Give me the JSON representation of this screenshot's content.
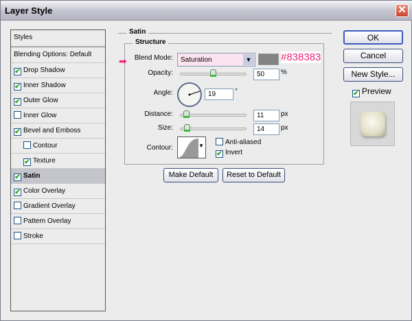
{
  "window": {
    "title": "Layer Style"
  },
  "sidebar": {
    "header": "Styles",
    "blending": "Blending Options: Default",
    "items": [
      {
        "label": "Drop Shadow",
        "checked": true
      },
      {
        "label": "Inner Shadow",
        "checked": true
      },
      {
        "label": "Outer Glow",
        "checked": true
      },
      {
        "label": "Inner Glow",
        "checked": false
      },
      {
        "label": "Bevel and Emboss",
        "checked": true
      },
      {
        "label": "Contour",
        "checked": false
      },
      {
        "label": "Texture",
        "checked": true
      },
      {
        "label": "Satin",
        "checked": true
      },
      {
        "label": "Color Overlay",
        "checked": true
      },
      {
        "label": "Gradient Overlay",
        "checked": false
      },
      {
        "label": "Pattern Overlay",
        "checked": false
      },
      {
        "label": "Stroke",
        "checked": false
      }
    ]
  },
  "satin": {
    "title": "Satin",
    "structure": "Structure",
    "blend_label": "Blend Mode:",
    "blend_value": "Saturation",
    "color": "#838383",
    "color_annotation": "#838383",
    "opacity_label": "Opacity:",
    "opacity": "50",
    "opacity_unit": "%",
    "angle_label": "Angle:",
    "angle": "19",
    "angle_unit": "°",
    "distance_label": "Distance:",
    "distance": "11",
    "distance_unit": "px",
    "size_label": "Size:",
    "size": "14",
    "size_unit": "px",
    "contour_label": "Contour:",
    "antialiased": "Anti-aliased",
    "invert": "Invert",
    "make_default": "Make Default",
    "reset_default": "Reset to Default"
  },
  "buttons": {
    "ok": "OK",
    "cancel": "Cancel",
    "new_style": "New Style...",
    "preview": "Preview"
  },
  "checkmark": "✔"
}
